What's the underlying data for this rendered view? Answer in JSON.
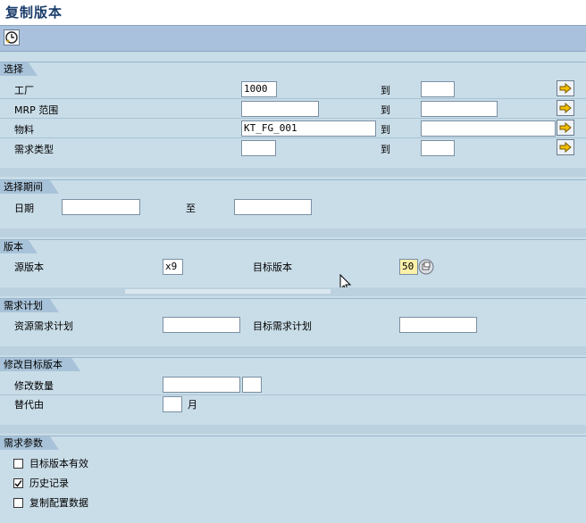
{
  "title": "复制版本",
  "toolbar": {
    "execute_icon": "clock-execute-icon"
  },
  "sections": {
    "selection": {
      "header": "选择",
      "rows": [
        {
          "label": "工厂",
          "from": "1000",
          "to_label": "到",
          "to": ""
        },
        {
          "label": "MRP 范围",
          "from": "",
          "to_label": "到",
          "to": ""
        },
        {
          "label": "物料",
          "from": "KT_FG_001",
          "to_label": "到",
          "to": ""
        },
        {
          "label": "需求类型",
          "from": "",
          "to_label": "到",
          "to": ""
        }
      ]
    },
    "period": {
      "header": "选择期间",
      "date_label": "日期",
      "date_from": "",
      "to_label": "至",
      "date_to": ""
    },
    "version": {
      "header": "版本",
      "source_label": "源版本",
      "source_value": "x9",
      "target_label": "目标版本",
      "target_value": "50"
    },
    "plan": {
      "header": "需求计划",
      "source_label": "资源需求计划",
      "source_value": "",
      "target_label": "目标需求计划",
      "target_value": ""
    },
    "modify": {
      "header": "修改目标版本",
      "qty_label": "修改数量",
      "qty_value": "",
      "qty_unit": "",
      "replace_label": "替代由",
      "replace_value": "",
      "month_label": "月"
    },
    "params": {
      "header": "需求参数",
      "options": [
        {
          "label": "目标版本有效",
          "checked": false
        },
        {
          "label": "历史记录",
          "checked": true
        },
        {
          "label": "复制配置数据",
          "checked": false
        }
      ]
    }
  }
}
